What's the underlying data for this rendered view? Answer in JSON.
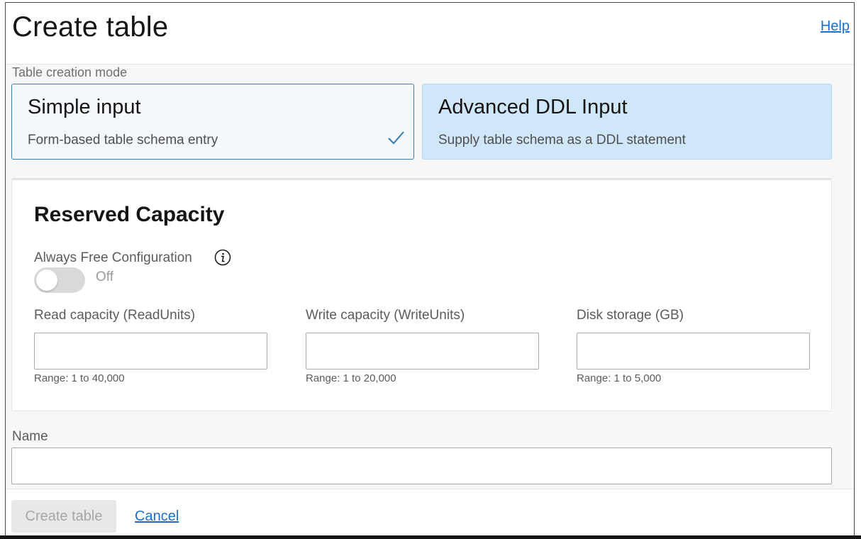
{
  "header": {
    "title": "Create table",
    "help_label": "Help"
  },
  "mode": {
    "label": "Table creation mode",
    "options": [
      {
        "title": "Simple input",
        "description": "Form-based table schema entry",
        "selected": true
      },
      {
        "title": "Advanced DDL Input",
        "description": "Supply table schema as a DDL statement",
        "selected": false
      }
    ]
  },
  "capacity": {
    "title": "Reserved Capacity",
    "always_free": {
      "label": "Always Free Configuration",
      "state": "Off",
      "enabled": false
    },
    "fields": [
      {
        "label": "Read capacity (ReadUnits)",
        "value": "",
        "hint": "Range: 1 to 40,000"
      },
      {
        "label": "Write capacity (WriteUnits)",
        "value": "",
        "hint": "Range: 1 to 20,000"
      },
      {
        "label": "Disk storage (GB)",
        "value": "",
        "hint": "Range: 1 to 5,000"
      }
    ]
  },
  "name": {
    "label": "Name",
    "value": ""
  },
  "footer": {
    "create_label": "Create table",
    "cancel_label": "Cancel"
  },
  "colors": {
    "link": "#1f6fc9",
    "selected_border": "#3e7fa6",
    "advanced_bg": "#cfe6fb",
    "check": "#2f7bb2",
    "disabled_text": "#a6a6a6"
  },
  "icons": {
    "selected_check": "check-icon",
    "tooltip": "info-icon"
  }
}
